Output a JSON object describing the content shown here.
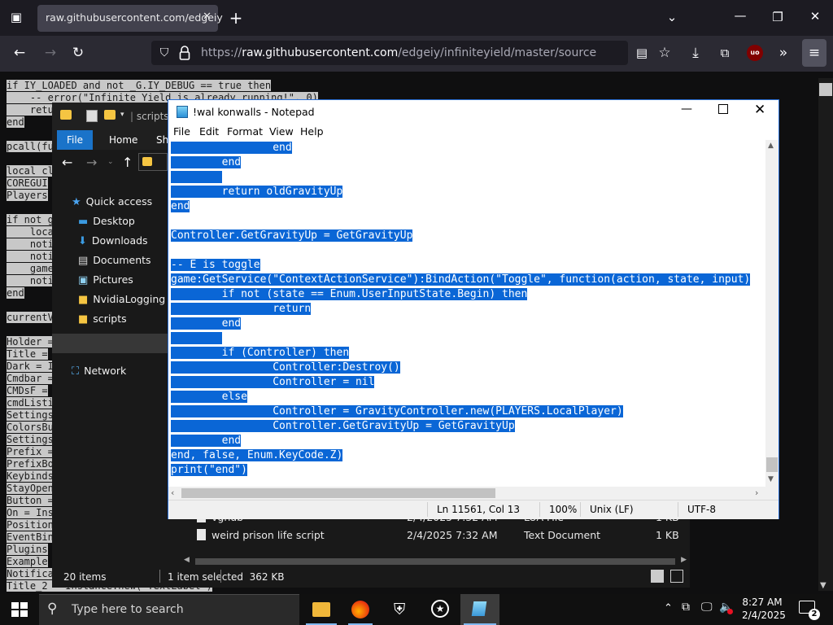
{
  "browser": {
    "tab_title": "raw.githubusercontent.com/edgeiy",
    "tab_close": "✕",
    "new_tab": "+",
    "url_prefix": "https://",
    "url_host": "raw.githubusercontent.com",
    "url_path": "/edgeiy/infiniteyield/master/source",
    "addon_badge": "uo"
  },
  "page": {
    "code_lines": [
      {
        "text": "if IY_LOADED and not _G.IY_DEBUG == true then",
        "sel": true
      },
      {
        "text": "    -- error(\"Infinite Yield is already running!\", 0)",
        "sel": true
      },
      {
        "text": "    retu",
        "sel": true
      },
      {
        "text": "end",
        "sel": true
      },
      {
        "text": "",
        "sel": false
      },
      {
        "text": "pcall(fu",
        "sel": true
      },
      {
        "text": "",
        "sel": false
      },
      {
        "text": "local cl",
        "sel": true
      },
      {
        "text": "COREGUI",
        "sel": true
      },
      {
        "text": "Players",
        "sel": true
      },
      {
        "text": "",
        "sel": false
      },
      {
        "text": "if not g",
        "sel": true
      },
      {
        "text": "    loca",
        "sel": true
      },
      {
        "text": "    noti",
        "sel": true
      },
      {
        "text": "    noti",
        "sel": true
      },
      {
        "text": "    game",
        "sel": true
      },
      {
        "text": "    noti",
        "sel": true
      },
      {
        "text": "end",
        "sel": true
      },
      {
        "text": "",
        "sel": false
      },
      {
        "text": "currentV",
        "sel": true
      },
      {
        "text": "",
        "sel": false
      },
      {
        "text": "Holder =",
        "sel": true
      },
      {
        "text": "Title =",
        "sel": true
      },
      {
        "text": "Dark = I",
        "sel": true
      },
      {
        "text": "Cmdbar =",
        "sel": true
      },
      {
        "text": "CMDsF =",
        "sel": true
      },
      {
        "text": "cmdListi",
        "sel": true
      },
      {
        "text": "Settings",
        "sel": true
      },
      {
        "text": "ColorsBu",
        "sel": true
      },
      {
        "text": "Settings",
        "sel": true
      },
      {
        "text": "Prefix =",
        "sel": true
      },
      {
        "text": "PrefixBo",
        "sel": true
      },
      {
        "text": "Keybinds",
        "sel": true
      },
      {
        "text": "StayOpen",
        "sel": true
      },
      {
        "text": "Button =",
        "sel": true
      },
      {
        "text": "On = Ins",
        "sel": true
      },
      {
        "text": "Position",
        "sel": true
      },
      {
        "text": "EventBin",
        "sel": true
      },
      {
        "text": "Plugins",
        "sel": true
      },
      {
        "text": "Example",
        "sel": true
      },
      {
        "text": "Notifica",
        "sel": true
      },
      {
        "text": "Title_2 = Instance.new(\"TextLabel\")",
        "sel": true
      }
    ]
  },
  "explorer": {
    "breadcrumb": "scripts",
    "ribbon_tabs": [
      "File",
      "Home",
      "Sh"
    ],
    "nav_items": [
      {
        "label": "Quick access",
        "icon": "star-icon",
        "indent": 0
      },
      {
        "label": "Desktop",
        "icon": "desktop-icon",
        "indent": 1
      },
      {
        "label": "Downloads",
        "icon": "download-icon",
        "indent": 1
      },
      {
        "label": "Documents",
        "icon": "document-icon",
        "indent": 1
      },
      {
        "label": "Pictures",
        "icon": "picture-icon",
        "indent": 1
      },
      {
        "label": "NvidiaLogging",
        "icon": "folder-icon",
        "indent": 1
      },
      {
        "label": "scripts",
        "icon": "folder-icon",
        "indent": 1
      },
      {
        "label": "This PC",
        "icon": "computer-icon",
        "indent": 0
      },
      {
        "label": "Network",
        "icon": "network-icon",
        "indent": 0
      }
    ],
    "files": [
      {
        "name": "vghub",
        "date": "2/4/2025 7:32 AM",
        "type": "LUA File",
        "size": "1 KB"
      },
      {
        "name": "weird prison life script",
        "date": "2/4/2025 7:32 AM",
        "type": "Text Document",
        "size": "1 KB"
      }
    ],
    "status": {
      "items": "20 items",
      "selected": "1 item selected  362 KB"
    }
  },
  "notepad": {
    "title": "!wal konwalls - Notepad",
    "menu": [
      "File",
      "Edit",
      "Format",
      "View",
      "Help"
    ],
    "lines": [
      "                end",
      "        end",
      "        ",
      "        return oldGravityUp",
      "end",
      "",
      "Controller.GetGravityUp = GetGravityUp",
      "",
      "-- E is toggle",
      "game:GetService(\"ContextActionService\"):BindAction(\"Toggle\", function(action, state, input)",
      "        if not (state == Enum.UserInputState.Begin) then",
      "                return",
      "        end",
      "        ",
      "        if (Controller) then",
      "                Controller:Destroy()",
      "                Controller = nil",
      "        else",
      "                Controller = GravityController.new(PLAYERS.LocalPlayer)",
      "                Controller.GetGravityUp = GetGravityUp",
      "        end",
      "end, false, Enum.KeyCode.Z)",
      "print(\"end\")"
    ],
    "status": {
      "position": "Ln 11561, Col 13",
      "zoom": "100%",
      "eol": "Unix (LF)",
      "encoding": "UTF-8"
    }
  },
  "taskbar": {
    "search_placeholder": "Type here to search",
    "time": "8:27 AM",
    "date": "2/4/2025",
    "notification_count": "2"
  },
  "colors": {
    "selection_blue": "#0a66d6",
    "explorer_file_tab": "#1a73c9"
  }
}
